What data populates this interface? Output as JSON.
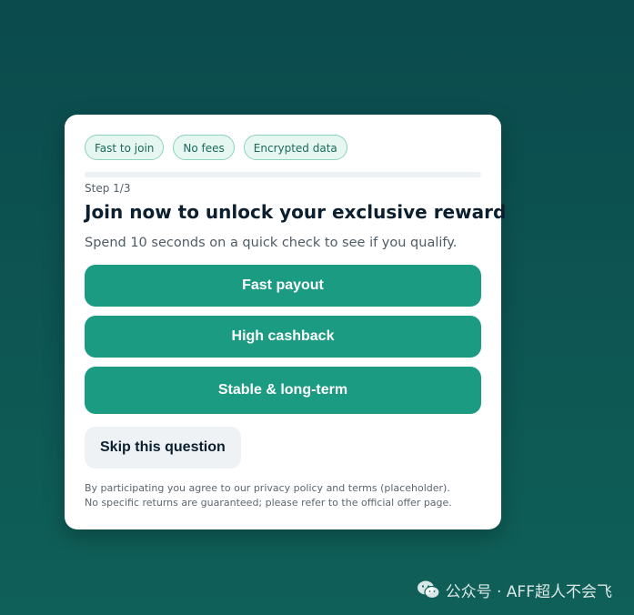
{
  "card": {
    "chips": [
      "Fast to join",
      "No fees",
      "Encrypted data"
    ],
    "progress": 0,
    "step": "Step 1/3",
    "title": "Join now to unlock your exclusive reward",
    "subtitle": "Spend 10 seconds on a quick check to see if you qualify.",
    "options": [
      "Fast payout",
      "High cashback",
      "Stable & long-term"
    ],
    "skip_label": "Skip this question",
    "disclaimer": "By participating you agree to our privacy policy and terms (placeholder). No specific returns are guaranteed; please refer to the official offer page."
  },
  "watermark": {
    "text": "公众号 · AFF超人不会飞",
    "icon": "wechat-icon"
  }
}
